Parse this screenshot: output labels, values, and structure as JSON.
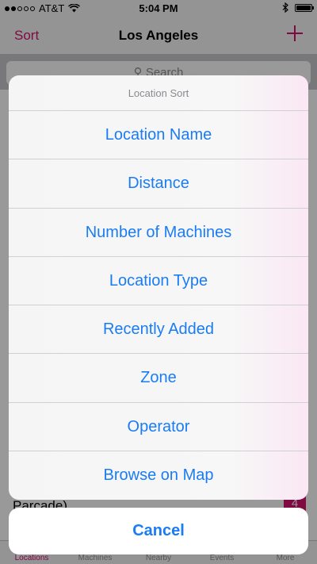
{
  "status_bar": {
    "carrier": "AT&T",
    "time": "5:04 PM",
    "signal_icon": "signal-dots-icon",
    "wifi_icon": "wifi-icon",
    "bluetooth_icon": "bluetooth-icon",
    "battery_icon": "battery-icon"
  },
  "nav": {
    "left_label": "Sort",
    "title": "Los Angeles",
    "add_icon": "plus-icon"
  },
  "search": {
    "placeholder": "Search",
    "icon": "search-icon"
  },
  "list": {
    "visible_row_text": "Parcade)",
    "badge": "4"
  },
  "action_sheet": {
    "title": "Location Sort",
    "items": [
      "Location Name",
      "Distance",
      "Number of Machines",
      "Location Type",
      "Recently Added",
      "Zone",
      "Operator",
      "Browse on Map"
    ],
    "cancel_label": "Cancel"
  },
  "tabs": [
    {
      "label": "Locations",
      "active": true
    },
    {
      "label": "Machines",
      "active": false
    },
    {
      "label": "Nearby",
      "active": false
    },
    {
      "label": "Events",
      "active": false
    },
    {
      "label": "More",
      "active": false
    }
  ],
  "colors": {
    "accent": "#d4116f",
    "action_blue": "#1a7cf5"
  }
}
